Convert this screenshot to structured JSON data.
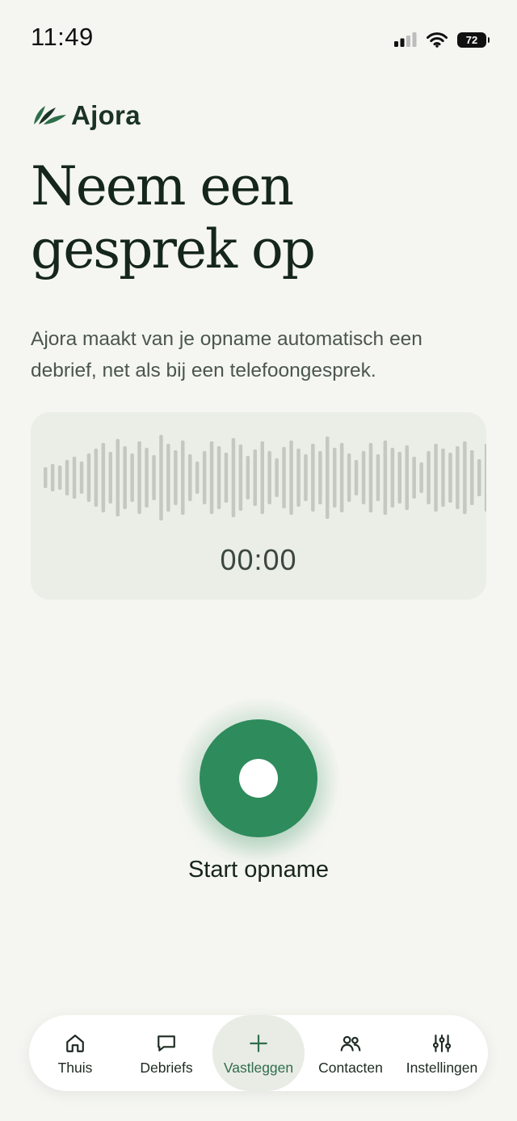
{
  "status_bar": {
    "time": "11:49",
    "battery": "72",
    "icons": [
      "signal-icon",
      "wifi-icon",
      "battery-icon"
    ]
  },
  "brand": {
    "name": "Ajora",
    "logo_icon": "leaf-logo-icon",
    "color": "#1a3324"
  },
  "main": {
    "headline_line1": "Neem een",
    "headline_line2": "gesprek op",
    "subtitle": "Ajora maakt van je opname automatisch een debrief, net als bij een telefoongesprek."
  },
  "recorder": {
    "timer": "00:00",
    "waveform_icon": "waveform-icon",
    "record_label": "Start opname",
    "accent_color": "#2e8b5c"
  },
  "bottom_nav": {
    "items": [
      {
        "label": "Thuis",
        "icon": "home-icon"
      },
      {
        "label": "Debriefs",
        "icon": "chat-bubble-icon"
      },
      {
        "label": "Vastleggen",
        "icon": "plus-icon",
        "active": true
      },
      {
        "label": "Contacten",
        "icon": "people-icon"
      },
      {
        "label": "Instellingen",
        "icon": "sliders-icon"
      }
    ]
  }
}
